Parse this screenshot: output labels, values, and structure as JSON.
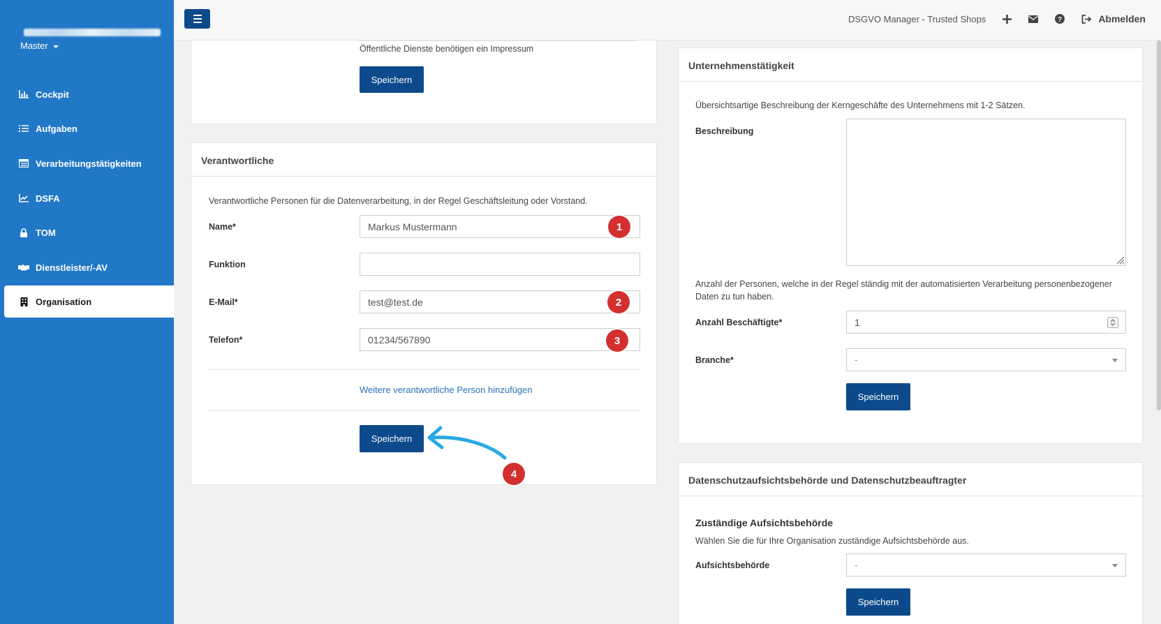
{
  "sidebar": {
    "account_label": "Master",
    "items": [
      {
        "label": "Cockpit",
        "icon": "bar-chart-icon"
      },
      {
        "label": "Aufgaben",
        "icon": "task-list-icon"
      },
      {
        "label": "Verarbeitungstätigkeiten",
        "icon": "list-table-icon"
      },
      {
        "label": "DSFA",
        "icon": "line-chart-icon"
      },
      {
        "label": "TOM",
        "icon": "lock-icon"
      },
      {
        "label": "Dienstleister/-AV",
        "icon": "handshake-icon"
      },
      {
        "label": "Organisation",
        "icon": "building-icon"
      }
    ],
    "active_item": "Organisation"
  },
  "topbar": {
    "app_name": "DSGVO Manager - Trusted Shops",
    "logout_label": "Abmelden"
  },
  "impressum_panel": {
    "note": "Öffentliche Dienste benötigen ein Impressum",
    "save_label": "Speichern"
  },
  "verantwortliche_panel": {
    "title": "Verantwortliche",
    "description": "Verantwortliche Personen für die Datenverarbeitung, in der Regel Geschäftsleitung oder Vorstand.",
    "fields": {
      "name": {
        "label": "Name*",
        "value": "Markus Mustermann"
      },
      "funktion": {
        "label": "Funktion",
        "value": ""
      },
      "email": {
        "label": "E-Mail*",
        "value": "test@test.de"
      },
      "telefon": {
        "label": "Telefon*",
        "value": "01234/567890"
      }
    },
    "add_person_link": "Weitere verantwortliche Person hinzufügen",
    "save_label": "Speichern"
  },
  "unternehmen_panel": {
    "title": "Unternehmenstätigkeit",
    "description": "Übersichtsartige Beschreibung der Kerngeschäfte des Unternehmens mit 1-2 Sätzen.",
    "beschreibung_label": "Beschreibung",
    "beschreibung_value": "",
    "persons_text": "Anzahl der Personen, welche in der Regel ständig mit der automatisierten Verarbeitung personenbezogener Daten zu tun haben.",
    "employees_label": "Anzahl Beschäftigte*",
    "employees_value": "1",
    "branche_label": "Branche*",
    "branche_value": "-",
    "save_label": "Speichern"
  },
  "datenschutz_panel": {
    "title": "Datenschutzaufsichtsbehörde und Datenschutzbeauftragter",
    "subtitle": "Zuständige Aufsichtsbehörde",
    "description": "Wählen Sie die für Ihre Organisation zuständige Aufsichtsbehörde aus.",
    "authority_label": "Aufsichtsbehörde",
    "authority_value": "-",
    "save_label": "Speichern"
  },
  "annotations": {
    "badge_1": "1",
    "badge_2": "2",
    "badge_3": "3",
    "badge_4": "4",
    "badge_color": "#d32f2f",
    "arrow_color": "#29a9e0"
  },
  "colors": {
    "sidebar_bg": "#2178c6",
    "primary_button": "#0d4a8b"
  }
}
